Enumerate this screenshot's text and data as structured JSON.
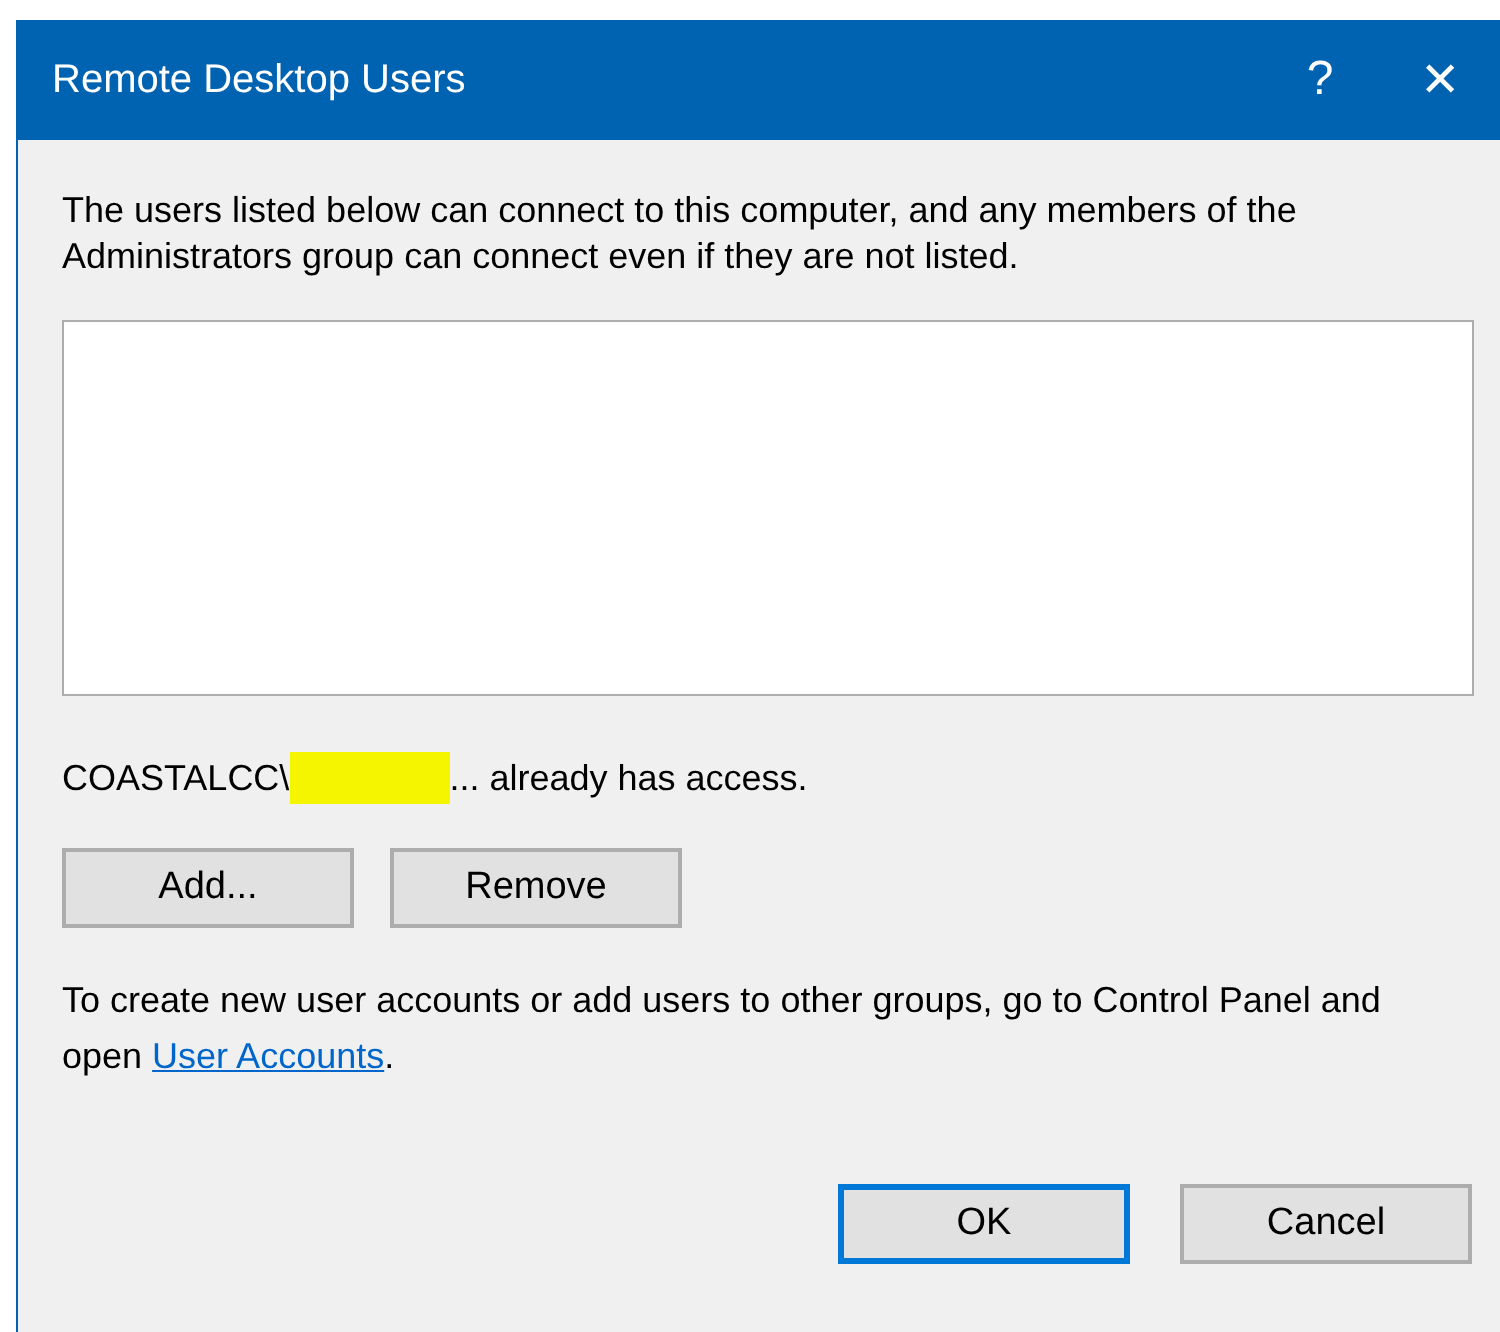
{
  "window": {
    "title": "Remote Desktop Users",
    "help_glyph": "?",
    "close_glyph": "✕"
  },
  "intro": "The users listed below can connect to this computer, and any members of the Administrators group can connect even if they are not listed.",
  "access": {
    "prefix": "COASTALCC\\",
    "redacted": true,
    "suffix": "... already has access."
  },
  "list_buttons": [
    {
      "label": "Add...",
      "default": false
    },
    {
      "label": "Remove",
      "default": false
    }
  ],
  "footer": {
    "text": "To create new user accounts or add users to other groups, go to Control Panel and open ",
    "link": "User Accounts",
    "end": "."
  },
  "buttons": [
    {
      "label": "OK",
      "default": true
    },
    {
      "label": "Cancel",
      "default": false
    }
  ]
}
